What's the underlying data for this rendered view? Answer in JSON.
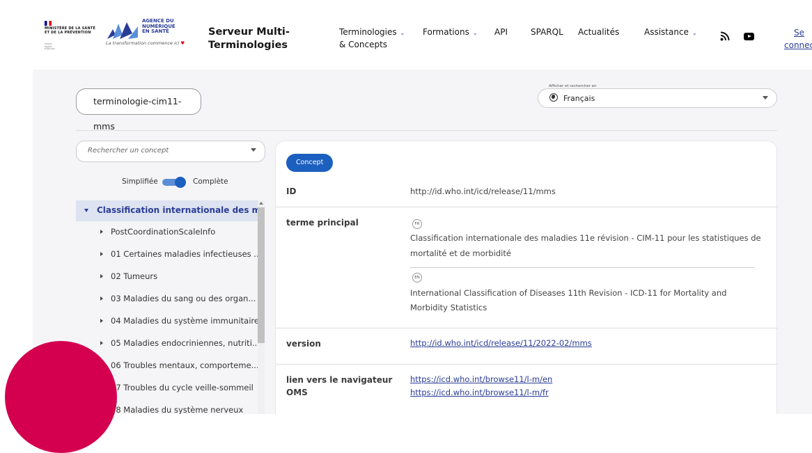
{
  "header": {
    "ministere": "MINISTÈRE DE LA SANTÉ ET DE LA PRÉVENTION",
    "devise": "Liberté Égalité Fraternité",
    "ans_name": "AGENCE DU NUMÉRIQUE EN SANTÉ",
    "ans_tagline": "La transformation commence ici",
    "site_title_line1": "Serveur Multi-",
    "site_title_line2": "Terminologies",
    "nav": [
      {
        "label": "Terminologies",
        "label2": "& Concepts",
        "has_dropdown": true
      },
      {
        "label": "Formations",
        "has_dropdown": true
      },
      {
        "label": "API",
        "has_dropdown": false
      },
      {
        "label": "SPARQL",
        "has_dropdown": false
      },
      {
        "label": "Actualités",
        "has_dropdown": false
      },
      {
        "label": "Assistance",
        "has_dropdown": true
      }
    ],
    "icons": [
      "rss-icon",
      "youtube-icon"
    ],
    "login_line1": "Se",
    "login_line2": "connecter"
  },
  "terminology": "terminologie-cim11-mms",
  "language_select": {
    "legend": "Afficher et rechercher en",
    "value": "Français"
  },
  "search": {
    "placeholder": "Rechercher un concept"
  },
  "view_toggle": {
    "left": "Simplifiée",
    "right": "Complète",
    "state": "Complète"
  },
  "tree": {
    "root": "Classification internationale des ma...",
    "items": [
      "PostCoordinationScaleInfo",
      "01 Certaines maladies infectieuses ...",
      "02 Tumeurs",
      "03 Maladies du sang ou des organ...",
      "04 Maladies du système immunitaire",
      "05 Maladies endocriniennes, nutriti...",
      "06 Troubles mentaux, comporteme...",
      "07 Troubles du cycle veille-sommeil",
      "08 Maladies du système nerveux"
    ]
  },
  "concept": {
    "badge": "Concept",
    "id_label": "ID",
    "id_value": "http://id.who.int/icd/release/11/mms",
    "terme_label": "terme principal",
    "terms": [
      {
        "lang": "FR",
        "text_line1": "Classification internationale des maladies 11e révision - CIM-11 pour les statistiques de",
        "text_line2": "mortalité et de morbidité"
      },
      {
        "lang": "EN",
        "text_line1": "International Classification of Diseases 11th Revision - ICD-11 for Mortality and",
        "text_line2": "Morbidity Statistics"
      }
    ],
    "version_label": "version",
    "version_value": "http://id.who.int/icd/release/11/2022-02/mms",
    "nav_label_line1": "lien vers le navigateur",
    "nav_label_line2": "OMS",
    "nav_links": [
      "https://icd.who.int/browse11/l-m/en",
      "https://icd.who.int/browse11/l-m/fr"
    ]
  },
  "colors": {
    "accent": "#1b5fbf",
    "link": "#2a3d96",
    "decor_circle": "#d4004f"
  }
}
